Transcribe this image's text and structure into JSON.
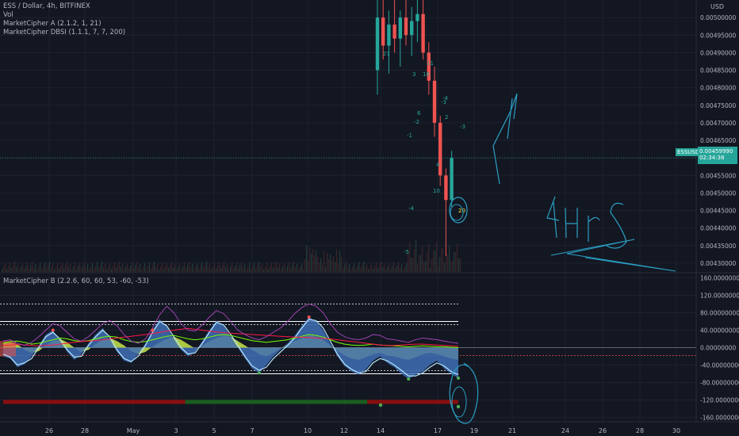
{
  "header": {
    "symbol_line": "ESS / Dollar, 4h, BITFINEX",
    "indicators": [
      "Vol",
      "MarketCipher A (2.1.2, 1, 21)",
      "MarketCipher DBSI (1.1.1, 7, 7, 200)"
    ],
    "lower_indicator": "MarketCipher B (2.2.6, 60, 60, 53, -60, -53)",
    "currency": "USD"
  },
  "price_tag": {
    "symbol": "ESSUSD",
    "price": "0.00459990",
    "countdown": "02:34:38"
  },
  "colors": {
    "background": "#131722",
    "up": "#26a69a",
    "down": "#ef5350",
    "grid": "#1e2230",
    "drawing": "#2b9fc4"
  },
  "handwriting": "4HRS",
  "chart_data": [
    {
      "type": "candlestick",
      "panel": "price",
      "ylim": [
        0.004275,
        0.00505
      ],
      "y_ticks": [
        "0.00500000",
        "0.00495000",
        "0.00490000",
        "0.00485000",
        "0.00480000",
        "0.00475000",
        "0.00470000",
        "0.00465000",
        "0.00460000",
        "0.00455000",
        "0.00450000",
        "0.00445000",
        "0.00440000",
        "0.00435000",
        "0.00430000"
      ],
      "y_tick_values": [
        0.005,
        0.00495,
        0.0049,
        0.00485,
        0.0048,
        0.00475,
        0.0047,
        0.00465,
        0.0046,
        0.00455,
        0.0045,
        0.00445,
        0.0044,
        0.00435,
        0.0043
      ],
      "current_price": 0.0045999,
      "candles": [
        {
          "i": 0,
          "o": 0.00485,
          "h": 0.00505,
          "l": 0.00478,
          "c": 0.005
        },
        {
          "i": 1,
          "o": 0.005,
          "h": 0.00505,
          "l": 0.00488,
          "c": 0.00492
        },
        {
          "i": 2,
          "o": 0.00492,
          "h": 0.00502,
          "l": 0.00484,
          "c": 0.00498
        },
        {
          "i": 3,
          "o": 0.00498,
          "h": 0.00505,
          "l": 0.0049,
          "c": 0.00494
        },
        {
          "i": 4,
          "o": 0.00494,
          "h": 0.00502,
          "l": 0.00486,
          "c": 0.005
        },
        {
          "i": 5,
          "o": 0.005,
          "h": 0.00505,
          "l": 0.00492,
          "c": 0.00495
        },
        {
          "i": 6,
          "o": 0.00495,
          "h": 0.00503,
          "l": 0.00489,
          "c": 0.00499
        },
        {
          "i": 7,
          "o": 0.00499,
          "h": 0.00505,
          "l": 0.00493,
          "c": 0.00501
        },
        {
          "i": 8,
          "o": 0.00501,
          "h": 0.00505,
          "l": 0.00488,
          "c": 0.0049
        },
        {
          "i": 9,
          "o": 0.0049,
          "h": 0.00493,
          "l": 0.00478,
          "c": 0.00482
        },
        {
          "i": 10,
          "o": 0.00482,
          "h": 0.00486,
          "l": 0.00466,
          "c": 0.0047
        },
        {
          "i": 11,
          "o": 0.0047,
          "h": 0.00472,
          "l": 0.00452,
          "c": 0.00455
        },
        {
          "i": 12,
          "o": 0.00455,
          "h": 0.00457,
          "l": 0.00432,
          "c": 0.00448
        },
        {
          "i": 13,
          "o": 0.00448,
          "h": 0.00462,
          "l": 0.00446,
          "c": 0.0046
        }
      ],
      "annotations": [
        "21",
        "3",
        "16",
        "11",
        "6",
        "-2",
        "-1",
        "-4",
        "-3",
        "4",
        "10",
        "-4",
        "-5",
        "2",
        "-3",
        "20"
      ]
    },
    {
      "type": "line",
      "panel": "oscillator",
      "ylim": [
        -170,
        170
      ],
      "y_ticks": [
        "160.00000000",
        "120.00000000",
        "80.00000000",
        "40.00000000",
        "0.00000000",
        "-40.00000000",
        "-80.00000000",
        "-120.00000000",
        "-160.00000000"
      ],
      "y_tick_values": [
        160,
        120,
        80,
        40,
        0,
        -40,
        -80,
        -120,
        -160
      ],
      "x_ticks": [
        "26",
        "28",
        "May",
        "3",
        "5",
        "7",
        "10",
        "12",
        "14",
        "17",
        "19",
        "21",
        "24",
        "26",
        "28",
        "30"
      ],
      "levels": [
        100,
        60,
        53,
        0,
        -53,
        -60
      ],
      "wave": [
        -20,
        -25,
        -45,
        -38,
        -20,
        5,
        30,
        40,
        15,
        -10,
        -28,
        -15,
        10,
        30,
        45,
        20,
        -10,
        -30,
        -35,
        -15,
        10,
        40,
        65,
        48,
        20,
        -5,
        -20,
        -10,
        15,
        40,
        62,
        50,
        25,
        0,
        -25,
        -48,
        -58,
        -40,
        -20,
        -5,
        10,
        28,
        50,
        70,
        60,
        40,
        10,
        -20,
        -42,
        -55,
        -62,
        -50,
        -30,
        -20,
        -35,
        -45,
        -60,
        -72,
        -62,
        -55,
        -40,
        -30,
        -48,
        -60,
        -70
      ],
      "wave_fast": [
        -15,
        -22,
        -40,
        -35,
        -25,
        0,
        25,
        35,
        20,
        -5,
        -22,
        -20,
        5,
        25,
        40,
        25,
        -5,
        -25,
        -32,
        -20,
        5,
        35,
        60,
        50,
        25,
        0,
        -15,
        -12,
        10,
        35,
        58,
        52,
        30,
        5,
        -20,
        -42,
        -52,
        -45,
        -25,
        -10,
        5,
        22,
        45,
        65,
        62,
        45,
        15,
        -15,
        -38,
        -50,
        -58,
        -55,
        -35,
        -25,
        -30,
        -40,
        -52,
        -65,
        -65,
        -58,
        -45,
        -35,
        -42,
        -55,
        -62
      ],
      "money_flow": [
        10,
        12,
        8,
        -5,
        -12,
        -8,
        5,
        15,
        20,
        12,
        0,
        -10,
        -5,
        8,
        18,
        22,
        15,
        5,
        -8,
        -15,
        -10,
        2,
        12,
        20,
        25,
        18,
        8,
        -2,
        5,
        15,
        22,
        28,
        25,
        15,
        5,
        -5,
        -15,
        -20,
        -12,
        -2,
        8,
        15,
        22,
        28,
        25,
        18,
        5,
        -8,
        -18,
        -25,
        -28,
        -22,
        -15,
        -12,
        -18,
        -20,
        -25,
        -28,
        -22,
        -15,
        -12,
        -15,
        -20,
        -25,
        -28
      ],
      "rsi_purple": [
        15,
        18,
        10,
        5,
        12,
        25,
        40,
        55,
        50,
        35,
        20,
        15,
        25,
        40,
        55,
        62,
        50,
        30,
        15,
        10,
        20,
        45,
        75,
        95,
        80,
        55,
        40,
        38,
        52,
        70,
        85,
        78,
        60,
        40,
        30,
        22,
        18,
        25,
        35,
        45,
        60,
        78,
        92,
        100,
        95,
        80,
        55,
        35,
        25,
        20,
        18,
        22,
        30,
        28,
        20,
        18,
        15,
        12,
        18,
        22,
        20,
        18,
        15,
        12,
        10
      ],
      "green_line": [
        10,
        14,
        15,
        12,
        8,
        10,
        14,
        18,
        22,
        20,
        16,
        14,
        16,
        20,
        24,
        26,
        24,
        18,
        14,
        12,
        14,
        18,
        22,
        26,
        28,
        24,
        20,
        18,
        20,
        24,
        28,
        30,
        28,
        24,
        20,
        16,
        14,
        12,
        14,
        16,
        18,
        22,
        26,
        30,
        28,
        24,
        18,
        12,
        8,
        6,
        5,
        6,
        8,
        6,
        5,
        4,
        3,
        2,
        3,
        4,
        3,
        2,
        2,
        1,
        0
      ],
      "red_line": [
        5,
        6,
        7,
        6,
        5,
        4,
        5,
        6,
        8,
        10,
        12,
        14,
        15,
        16,
        18,
        20,
        22,
        24,
        26,
        28,
        30,
        32,
        35,
        38,
        40,
        42,
        44,
        42,
        40,
        38,
        36,
        34,
        33,
        32,
        31,
        30,
        29,
        28,
        27,
        26,
        25,
        24,
        24,
        23,
        22,
        21,
        20,
        18,
        16,
        14,
        12,
        10,
        8,
        6,
        5,
        5,
        6,
        7,
        8,
        8,
        7,
        6,
        5,
        4,
        3
      ],
      "bottom_bar": [
        {
          "from": 0,
          "to": 0.4,
          "color": "#880e0e"
        },
        {
          "from": 0.4,
          "to": 0.8,
          "color": "#1b5e20"
        },
        {
          "from": 0.8,
          "to": 1,
          "color": "#880e0e"
        }
      ],
      "markers": [
        {
          "series": "wave",
          "index": 7,
          "color": "#ef5350"
        },
        {
          "series": "wave",
          "index": 21,
          "color": "#ef5350"
        },
        {
          "series": "wave",
          "index": 43,
          "color": "#ef5350"
        },
        {
          "series": "wave",
          "index": 36,
          "color": "#4caf50"
        },
        {
          "series": "wave",
          "index": 57,
          "color": "#4caf50"
        },
        {
          "series": "wave",
          "index": 64,
          "color": "#4caf50"
        }
      ]
    }
  ]
}
